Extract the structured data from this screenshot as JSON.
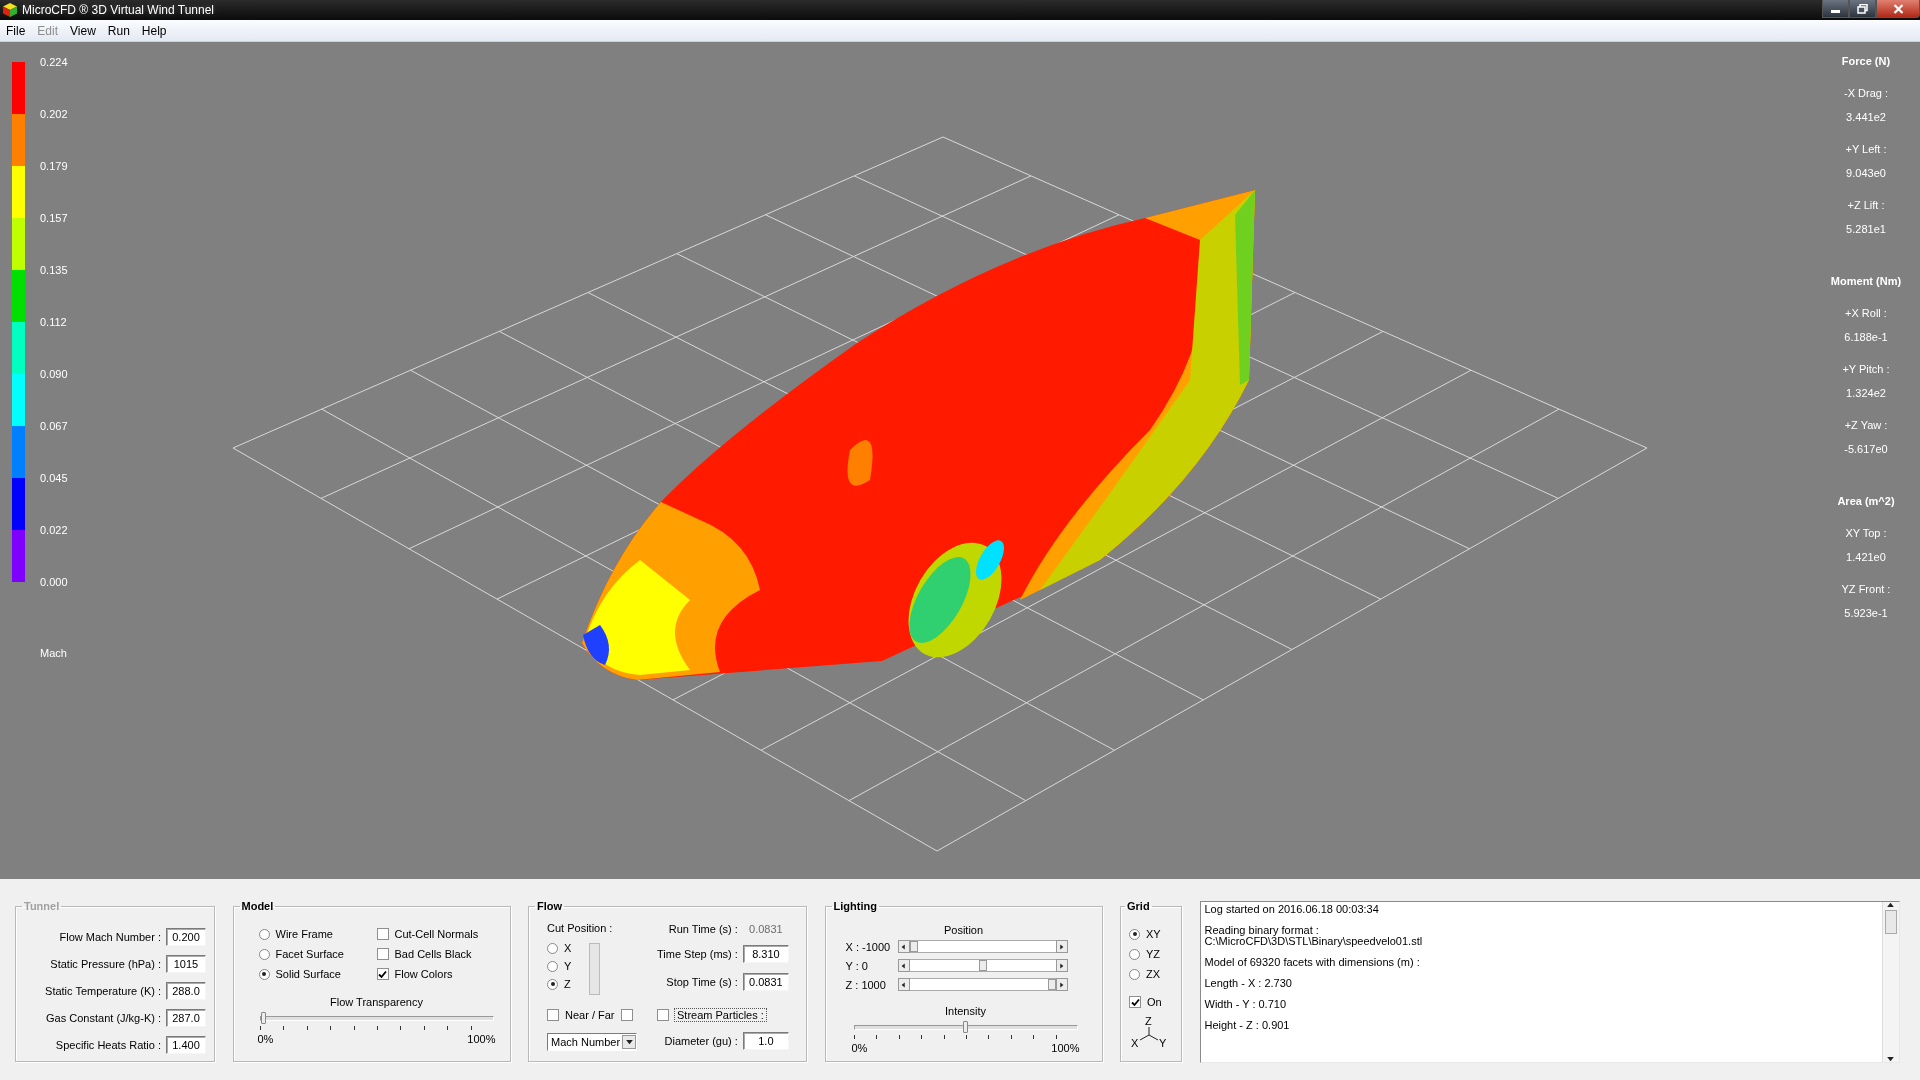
{
  "window": {
    "title": "MicroCFD ® 3D Virtual Wind Tunnel"
  },
  "menu": [
    {
      "label": "File",
      "disabled": false
    },
    {
      "label": "Edit",
      "disabled": true
    },
    {
      "label": "View",
      "disabled": false
    },
    {
      "label": "Run",
      "disabled": false
    },
    {
      "label": "Help",
      "disabled": false
    }
  ],
  "legend": {
    "ticks": [
      "0.224",
      "0.202",
      "0.179",
      "0.157",
      "0.135",
      "0.112",
      "0.090",
      "0.067",
      "0.045",
      "0.022",
      "0.000"
    ],
    "segments": [
      {
        "color": "#ff0000"
      },
      {
        "color": "#ff8000"
      },
      {
        "color": "#ffff00"
      },
      {
        "color": "#c0ff00"
      },
      {
        "color": "#00e000"
      },
      {
        "color": "#00ffc0"
      },
      {
        "color": "#00ffff"
      },
      {
        "color": "#0080ff"
      },
      {
        "color": "#0000ff"
      },
      {
        "color": "#8000ff"
      }
    ],
    "unit": "Mach"
  },
  "results": [
    {
      "title": "Force (N)",
      "items": [
        {
          "label": "-X Drag :",
          "value": "3.441e2"
        },
        {
          "label": "+Y Left :",
          "value": "9.043e0"
        },
        {
          "label": "+Z Lift :",
          "value": "5.281e1"
        }
      ]
    },
    {
      "title": "Moment (Nm)",
      "items": [
        {
          "label": "+X Roll :",
          "value": "6.188e-1"
        },
        {
          "label": "+Y Pitch :",
          "value": "1.324e2"
        },
        {
          "label": "+Z Yaw :",
          "value": "-5.617e0"
        }
      ]
    },
    {
      "title": "Area (m^2)",
      "items": [
        {
          "label": "XY Top :",
          "value": "1.421e0"
        },
        {
          "label": "YZ Front :",
          "value": "5.923e-1"
        }
      ]
    }
  ],
  "tunnel": {
    "title": "Tunnel",
    "disabled": true,
    "fields": [
      {
        "label": "Flow Mach Number :",
        "value": "0.200"
      },
      {
        "label": "Static Pressure (hPa) :",
        "value": "1015"
      },
      {
        "label": "Static Temperature (K) :",
        "value": "288.0"
      },
      {
        "label": "Gas Constant (J/kg-K) :",
        "value": "287.0"
      },
      {
        "label": "Specific Heats Ratio :",
        "value": "1.400"
      }
    ]
  },
  "model": {
    "title": "Model",
    "disabled": false,
    "radios": [
      {
        "label": "Wire Frame",
        "selected": false
      },
      {
        "label": "Facet Surface",
        "selected": false
      },
      {
        "label": "Solid Surface",
        "selected": true
      }
    ],
    "checkboxes": [
      {
        "label": "Cut-Cell Normals",
        "checked": false
      },
      {
        "label": "Bad Cells Black",
        "checked": false
      },
      {
        "label": "Flow Colors",
        "checked": true
      }
    ],
    "transparency": {
      "label": "Flow Transparency",
      "level": 0,
      "min_label": "0%",
      "max_label": "100%"
    }
  },
  "flow": {
    "title": "Flow",
    "disabled": false,
    "cut_label": "Cut Position :",
    "cut_axes": [
      {
        "label": "X",
        "selected": false
      },
      {
        "label": "Y",
        "selected": false
      },
      {
        "label": "Z",
        "selected": true
      }
    ],
    "near_far": {
      "label": "Near / Far",
      "checked": false,
      "far_checked": false
    },
    "quantity": "Mach Number",
    "run_time": {
      "label": "Run Time (s) :",
      "value": "0.0831"
    },
    "fields": [
      {
        "label": "Time Step (ms) :",
        "value": "8.310"
      },
      {
        "label": "Stop Time (s) :",
        "value": "0.0831"
      }
    ],
    "stream_particles": {
      "label": "Stream Particles :",
      "checked": false
    },
    "diameter": {
      "label": "Diameter (gu) :",
      "value": "1.0"
    }
  },
  "lighting": {
    "title": "Lighting",
    "disabled": false,
    "position_label": "Position",
    "axes": [
      {
        "label": "X : -1000",
        "level": 0
      },
      {
        "label": "Y : 0",
        "level": 0.5
      },
      {
        "label": "Z : 1000",
        "level": 1
      }
    ],
    "intensity": {
      "label": "Intensity",
      "level": 0.5,
      "min_label": "0%",
      "max_label": "100%"
    }
  },
  "grid": {
    "title": "Grid",
    "disabled": false,
    "planes": [
      {
        "label": "XY",
        "selected": true
      },
      {
        "label": "YZ",
        "selected": false
      },
      {
        "label": "ZX",
        "selected": false
      }
    ],
    "on": {
      "label": "On",
      "checked": true
    },
    "axes": [
      "Z",
      "X",
      "Y"
    ]
  },
  "log": {
    "paragraphs": [
      [
        "Log started on 2016.06.18 00:03:34"
      ],
      [
        "Reading binary format :",
        "C:\\MicroCFD\\3D\\STL\\Binary\\speedvelo01.stl"
      ],
      [
        "Model of 69320 facets with dimensions (m) :"
      ],
      [
        "Length - X : 2.730"
      ],
      [
        "Width - Y : 0.710"
      ],
      [
        "Height - Z : 0.901"
      ]
    ]
  }
}
